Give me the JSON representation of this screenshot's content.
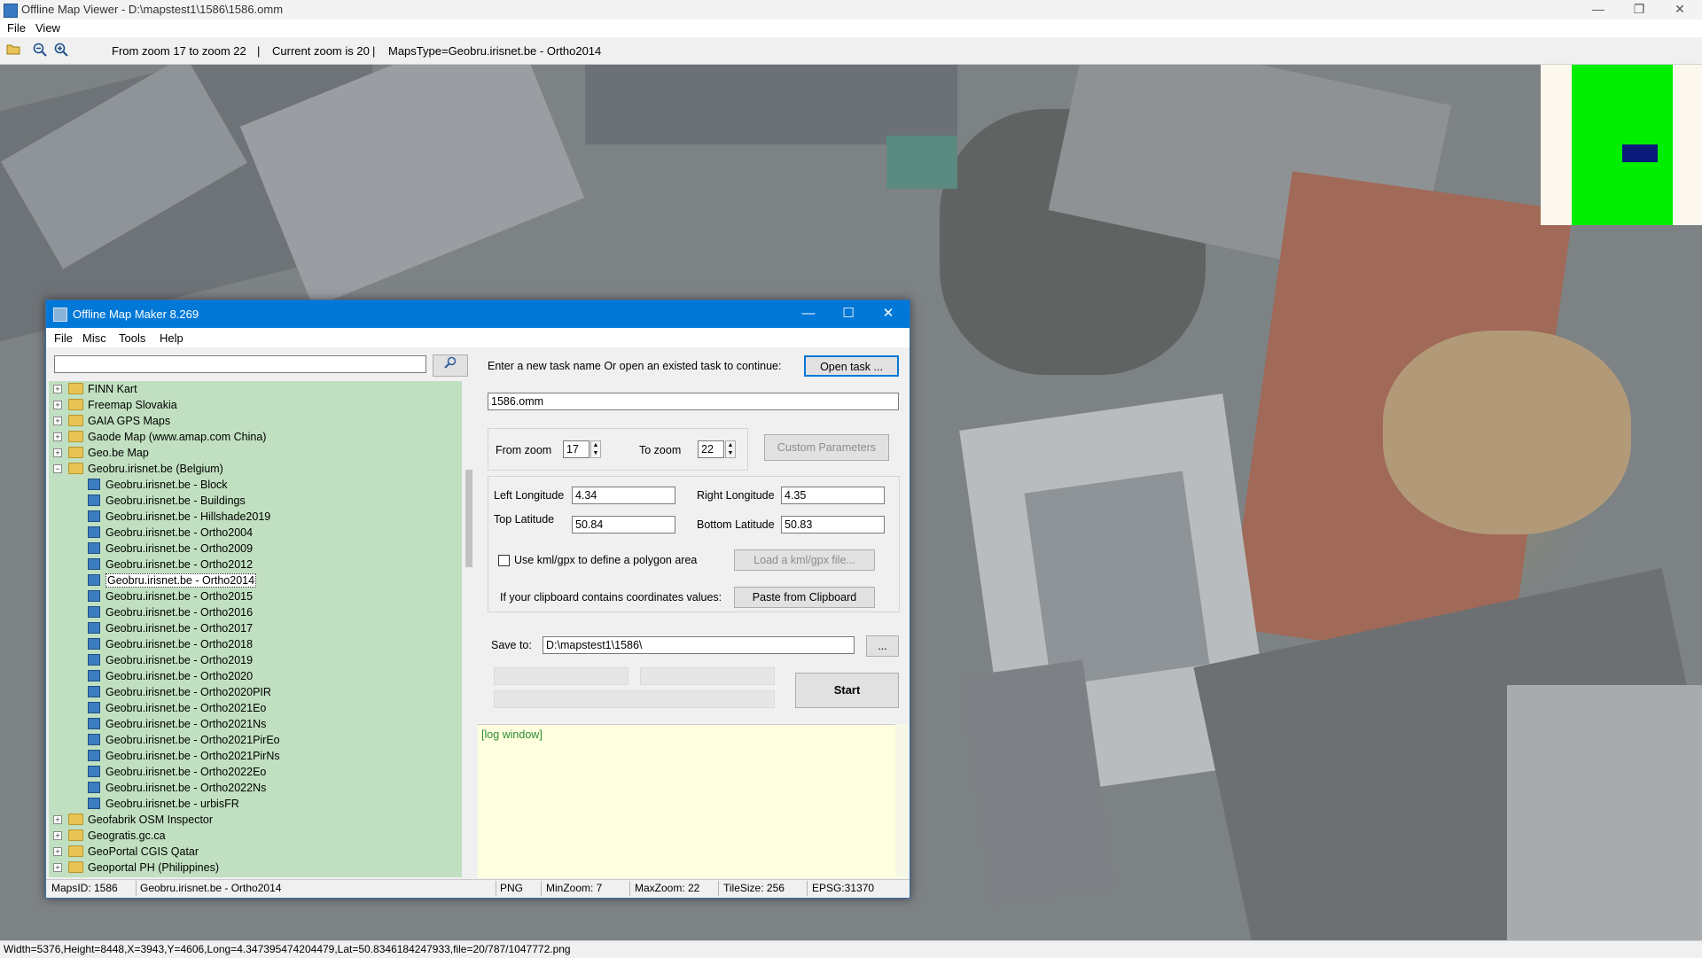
{
  "viewer": {
    "title": "Offline Map Viewer - D:\\mapstest1\\1586\\1586.omm",
    "menu": [
      "File",
      "View"
    ],
    "zoom_range": "From zoom 17 to zoom 22",
    "current_zoom": "Current zoom is 20",
    "maps_type": "MapsType=Geobru.irisnet.be - Ortho2014",
    "status": "Width=5376,Height=8448,X=3943,Y=4606,Long=4.347395474204479,Lat=50.8346184247933,file=20/787/1047772.png",
    "window_buttons": {
      "minimize": "—",
      "restore": "❐",
      "close": "✕"
    },
    "toolbar_icons": [
      "open-folder-icon",
      "zoom-out-icon",
      "zoom-in-icon"
    ]
  },
  "maker": {
    "title": "Offline Map Maker 8.269",
    "menu": [
      "File",
      "Misc",
      "Tools",
      "Help"
    ],
    "search_placeholder": "",
    "search_icon": "🔎",
    "tree": [
      {
        "label": "FINN Kart",
        "type": "folder"
      },
      {
        "label": "Freemap Slovakia",
        "type": "folder"
      },
      {
        "label": "GAIA GPS Maps",
        "type": "folder"
      },
      {
        "label": "Gaode Map (www.amap.com China)",
        "type": "folder"
      },
      {
        "label": "Geo.be Map",
        "type": "folder"
      },
      {
        "label": "Geobru.irisnet.be (Belgium)",
        "type": "folder",
        "expanded": true
      },
      {
        "label": "Geobru.irisnet.be - Block",
        "type": "map"
      },
      {
        "label": "Geobru.irisnet.be - Buildings",
        "type": "map"
      },
      {
        "label": "Geobru.irisnet.be - Hillshade2019",
        "type": "map"
      },
      {
        "label": "Geobru.irisnet.be - Ortho2004",
        "type": "map"
      },
      {
        "label": "Geobru.irisnet.be - Ortho2009",
        "type": "map"
      },
      {
        "label": "Geobru.irisnet.be - Ortho2012",
        "type": "map"
      },
      {
        "label": "Geobru.irisnet.be - Ortho2014",
        "type": "map",
        "selected": true
      },
      {
        "label": "Geobru.irisnet.be - Ortho2015",
        "type": "map"
      },
      {
        "label": "Geobru.irisnet.be - Ortho2016",
        "type": "map"
      },
      {
        "label": "Geobru.irisnet.be - Ortho2017",
        "type": "map"
      },
      {
        "label": "Geobru.irisnet.be - Ortho2018",
        "type": "map"
      },
      {
        "label": "Geobru.irisnet.be - Ortho2019",
        "type": "map"
      },
      {
        "label": "Geobru.irisnet.be - Ortho2020",
        "type": "map"
      },
      {
        "label": "Geobru.irisnet.be - Ortho2020PIR",
        "type": "map"
      },
      {
        "label": "Geobru.irisnet.be - Ortho2021Eo",
        "type": "map"
      },
      {
        "label": "Geobru.irisnet.be - Ortho2021Ns",
        "type": "map"
      },
      {
        "label": "Geobru.irisnet.be - Ortho2021PirEo",
        "type": "map"
      },
      {
        "label": "Geobru.irisnet.be - Ortho2021PirNs",
        "type": "map"
      },
      {
        "label": "Geobru.irisnet.be - Ortho2022Eo",
        "type": "map"
      },
      {
        "label": "Geobru.irisnet.be - Ortho2022Ns",
        "type": "map"
      },
      {
        "label": "Geobru.irisnet.be - urbisFR",
        "type": "map"
      },
      {
        "label": "Geofabrik OSM Inspector",
        "type": "folder"
      },
      {
        "label": "Geogratis.gc.ca",
        "type": "folder"
      },
      {
        "label": "GeoPortal CGIS Qatar",
        "type": "folder"
      },
      {
        "label": "Geoportal PH (Philippines)",
        "type": "folder"
      }
    ],
    "task_prompt": "Enter a new task name Or open an existed task to continue:",
    "open_task_label": "Open task ...",
    "task_name": "1586.omm",
    "from_zoom_label": "From zoom",
    "from_zoom": "17",
    "to_zoom_label": "To zoom",
    "to_zoom": "22",
    "custom_params_label": "Custom Parameters",
    "left_lon_label": "Left Longitude",
    "left_lon": "4.34",
    "right_lon_label": "Right Longitude",
    "right_lon": "4.35",
    "top_lat_label": "Top Latitude",
    "top_lat": "50.84",
    "bottom_lat_label": "Bottom Latitude",
    "bottom_lat": "50.83",
    "kml_label": "Use kml/gpx to define a polygon area",
    "load_kml_label": "Load a kml/gpx file...",
    "clipboard_prompt": "If your clipboard contains coordinates values:",
    "paste_label": "Paste from Clipboard",
    "save_to_label": "Save to:",
    "save_path": "D:\\mapstest1\\1586\\",
    "browse_label": "...",
    "start_label": "Start",
    "log_label": "[log window]",
    "status": {
      "maps_id": "MapsID: 1586",
      "map_name": "Geobru.irisnet.be - Ortho2014",
      "format": "PNG",
      "min_zoom": "MinZoom: 7",
      "max_zoom": "MaxZoom: 22",
      "tile_size": "TileSize: 256",
      "epsg": "EPSG:31370"
    }
  }
}
